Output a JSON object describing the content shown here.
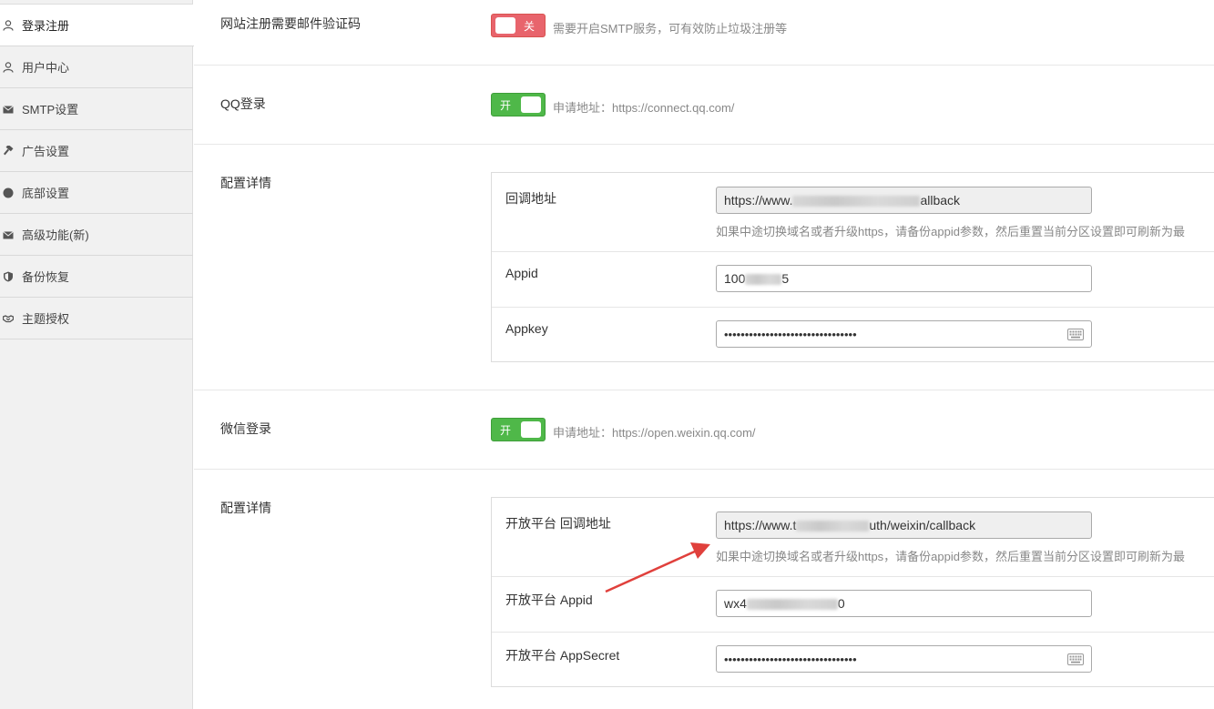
{
  "sidebar": {
    "items": [
      {
        "label": "登录注册",
        "icon": "user-icon",
        "active": true
      },
      {
        "label": "用户中心",
        "icon": "user-icon",
        "active": false
      },
      {
        "label": "SMTP设置",
        "icon": "envelope-icon",
        "active": false
      },
      {
        "label": "广告设置",
        "icon": "hammer-icon",
        "active": false
      },
      {
        "label": "底部设置",
        "icon": "circle-icon",
        "active": false
      },
      {
        "label": "高级功能(新)",
        "icon": "envelope-icon",
        "active": false
      },
      {
        "label": "备份恢复",
        "icon": "shield-icon",
        "active": false
      },
      {
        "label": "主题授权",
        "icon": "handshake-icon",
        "active": false
      }
    ]
  },
  "email_verify": {
    "label": "网站注册需要邮件验证码",
    "switch_text": "关",
    "state": "off",
    "hint": "需要开启SMTP服务，可有效防止垃圾注册等"
  },
  "qq_login": {
    "label": "QQ登录",
    "switch_text": "开",
    "state": "on",
    "hint": "申请地址：https://connect.qq.com/"
  },
  "qq_config": {
    "label": "配置详情",
    "callback": {
      "label": "回调地址",
      "value_prefix": "https://www.",
      "value_suffix": "allback",
      "hint": "如果中途切换域名或者升级https，请备份appid参数，然后重置当前分区设置即可刷新为最"
    },
    "appid": {
      "label": "Appid",
      "value_prefix": "100",
      "value_suffix": "5"
    },
    "appkey": {
      "label": "Appkey",
      "value": "••••••••••••••••••••••••••••••••",
      "icon": "keyboard-icon"
    }
  },
  "wechat_login": {
    "label": "微信登录",
    "switch_text": "开",
    "state": "on",
    "hint": "申请地址：https://open.weixin.qq.com/"
  },
  "wechat_config": {
    "label": "配置详情",
    "callback": {
      "label": "开放平台 回调地址",
      "value_prefix": "https://www.t",
      "value_suffix": "uth/weixin/callback",
      "hint": "如果中途切换域名或者升级https，请备份appid参数，然后重置当前分区设置即可刷新为最"
    },
    "appid": {
      "label": "开放平台 Appid",
      "value_prefix": "wx4",
      "value_suffix": "0"
    },
    "appsecret": {
      "label": "开放平台 AppSecret",
      "value": "••••••••••••••••••••••••••••••••",
      "icon": "keyboard-icon"
    }
  },
  "colors": {
    "switch_on": "#4fb849",
    "switch_off": "#e8646c",
    "annotation_arrow": "#e0403c"
  }
}
